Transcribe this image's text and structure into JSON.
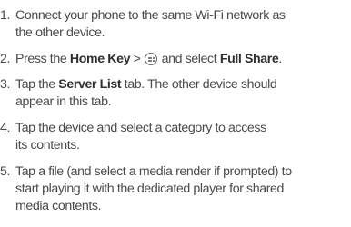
{
  "steps": [
    {
      "number": "1.",
      "lines": [
        "Connect your phone to the same Wi-Fi network as",
        "the other device."
      ]
    },
    {
      "number": "2.",
      "prefix": "Press the ",
      "home_key": "Home Key",
      "separator": " > ",
      "icon": "apps-grid-icon",
      "middle": " and select ",
      "full_share": "Full Share",
      "end": "."
    },
    {
      "number": "3.",
      "prefix": "Tap the ",
      "server_list": "Server List",
      "rest": " tab. The other device should",
      "line2": "appear in this tab."
    },
    {
      "number": "4.",
      "lines": [
        "Tap the device and select a category to access",
        "its contents."
      ]
    },
    {
      "number": "5.",
      "lines": [
        "Tap a file (and select a media render if prompted) to",
        "start playing it with the dedicated player for shared",
        "media contents."
      ]
    }
  ]
}
